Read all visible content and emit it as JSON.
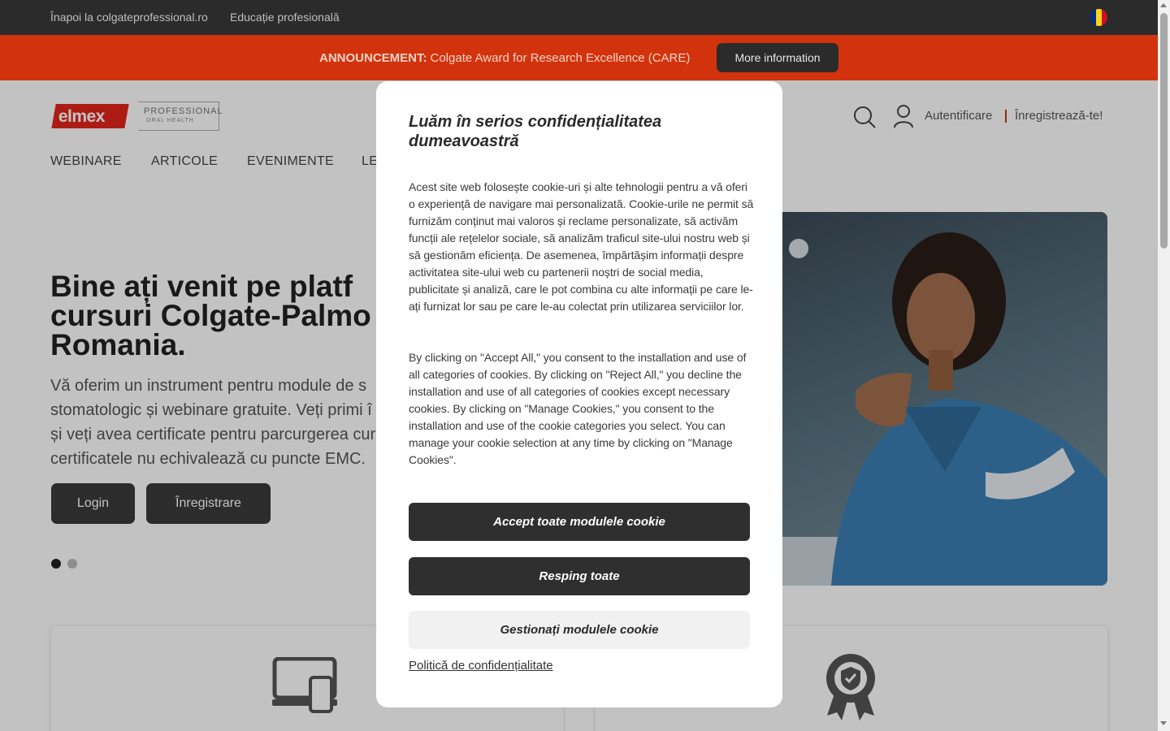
{
  "topbar": {
    "back_link": "Înapoi la colgateprofessional.ro",
    "education_link": "Educație profesională",
    "flag_colors": [
      "#002b7f",
      "#fcd116",
      "#ce1126"
    ]
  },
  "announcement": {
    "label": "ANNOUNCEMENT:",
    "text": "Colgate Award for Research Excellence (CARE)",
    "button": "More information"
  },
  "header": {
    "logo_brand": "elmex",
    "logo_line1": "PROFESSIONAL",
    "logo_line2": "ORAL HEALTH",
    "login_link": "Autentificare",
    "register_link": "Înregistrează-te!",
    "nav": [
      "WEBINARE",
      "ARTICOLE",
      "EVENIMENTE",
      "LE"
    ]
  },
  "hero": {
    "title_lines": [
      "Bine ați venit pe platf",
      "cursuri Colgate-Palmo",
      "Romania."
    ],
    "desc_lines": [
      "Vă oferim un instrument pentru module de s",
      "stomatologic și webinare gratuite. Veți primi î",
      "și veți avea certificate pentru parcurgerea cur",
      "certificatele nu echivalează cu puncte EMC."
    ],
    "login_button": "Login",
    "register_button": "Înregistrare",
    "slides_total": 2,
    "slide_active": 1
  },
  "cookie_modal": {
    "title": "Luăm în serios confidențialitatea dumeavoastră",
    "paragraph1": "Acest site web folosește cookie-uri și alte tehnologii pentru a vă oferi o experiență de navigare mai personalizată. Cookie-urile ne permit să furnizăm conținut mai valoros și reclame personalizate, să activăm funcții ale rețelelor sociale, să analizăm traficul site-ului nostru web și să gestionăm eficiența. De asemenea, împărtășim informații despre activitatea site-ului web cu partenerii noștri de social media, publicitate și analiză, care le pot combina cu alte informații pe care le-ați furnizat lor sau pe care le-au colectat prin utilizarea serviciilor lor.",
    "paragraph2": "By clicking on \"Accept All,\" you consent to the installation and use of all categories of cookies. By clicking on \"Reject All,\" you decline the installation and use of all categories of cookies except necessary cookies. By clicking on \"Manage Cookies,\" you consent to the installation and use of the cookie categories you select. You can manage your cookie selection at any time by clicking on \"Manage Cookies\".",
    "accept_button": "Accept toate modulele cookie",
    "reject_button": "Resping toate",
    "manage_button": "Gestionați modulele cookie",
    "policy_link": "Politică de confidențialitate"
  },
  "colors": {
    "announcement_bg": "#d2330c",
    "topbar_bg": "#2b2b2b",
    "button_dark": "#2f2f2f"
  },
  "icons": {
    "search": "search-icon",
    "user": "user-icon",
    "devices": "devices-icon",
    "certificate": "certificate-badge-icon"
  }
}
